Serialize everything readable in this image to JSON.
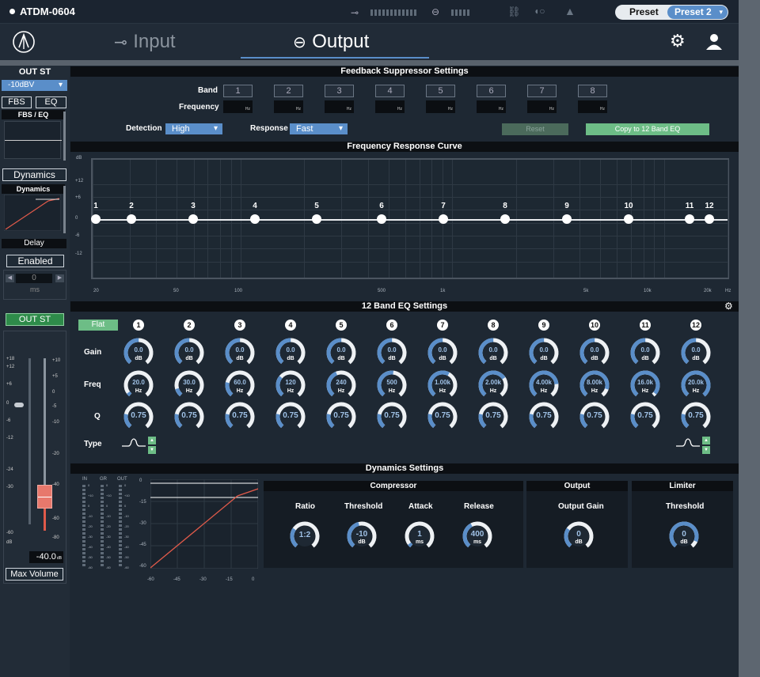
{
  "app": {
    "device": "ATDM-0604",
    "preset_label": "Preset",
    "preset_value": "Preset 2"
  },
  "nav": {
    "input": "Input",
    "output": "Output"
  },
  "left": {
    "channel": "OUT ST",
    "level_select": "-10dBV",
    "fbs_btn": "FBS",
    "eq_btn": "EQ",
    "fbs_eq_label": "FBS / EQ",
    "dynamics_btn": "Dynamics",
    "dynamics_label": "Dynamics",
    "delay_label": "Delay",
    "enabled_btn": "Enabled",
    "delay_value": "0",
    "delay_unit": "ms",
    "out_btn": "OUT ST",
    "fader_scale_left": [
      "+18",
      "+12",
      "+6",
      "0",
      "-6",
      "-12",
      "-24",
      "-30",
      "-60",
      "dB"
    ],
    "fader_scale_right": [
      "+10",
      "+5",
      "0",
      "-5",
      "-10",
      "-20",
      "-40",
      "-60",
      "-80"
    ],
    "fader_value": "-40.0",
    "fader_unit": "dB",
    "max_volume_btn": "Max Volume"
  },
  "fbs": {
    "title": "Feedback Suppressor Settings",
    "band_label": "Band",
    "freq_label": "Frequency",
    "bands": [
      "1",
      "2",
      "3",
      "4",
      "5",
      "6",
      "7",
      "8"
    ],
    "hz": "Hz",
    "detection_label": "Detection",
    "detection_value": "High",
    "response_label": "Response",
    "response_value": "Fast",
    "reset_btn": "Reset",
    "copy_btn": "Copy to 12 Band EQ"
  },
  "curve": {
    "title": "Frequency Response Curve",
    "y_unit": "dB",
    "y_ticks": [
      "+12",
      "+6",
      "0",
      "-6",
      "-12"
    ],
    "x_ticks": [
      "20",
      "50",
      "100",
      "500",
      "1k",
      "5k",
      "10k",
      "20k"
    ],
    "x_unit": "Hz",
    "nodes": [
      "1",
      "2",
      "3",
      "4",
      "5",
      "6",
      "7",
      "8",
      "9",
      "10",
      "11",
      "12"
    ]
  },
  "eq": {
    "title": "12 Band EQ Settings",
    "flat_btn": "Flat",
    "gain_label": "Gain",
    "freq_label": "Freq",
    "q_label": "Q",
    "type_label": "Type",
    "bands": [
      "1",
      "2",
      "3",
      "4",
      "5",
      "6",
      "7",
      "8",
      "9",
      "10",
      "11",
      "12"
    ],
    "gain": [
      "0.0",
      "0.0",
      "0.0",
      "0.0",
      "0.0",
      "0.0",
      "0.0",
      "0.0",
      "0.0",
      "0.0",
      "0.0",
      "0.0"
    ],
    "gain_unit": "dB",
    "freq": [
      "20.0",
      "30.0",
      "60.0",
      "120",
      "240",
      "500",
      "1.00k",
      "2.00k",
      "4.00k",
      "8.00k",
      "16.0k",
      "20.0k"
    ],
    "freq_fill": [
      0.05,
      0.12,
      0.22,
      0.32,
      0.42,
      0.52,
      0.6,
      0.7,
      0.8,
      0.88,
      0.96,
      1.0
    ],
    "freq_unit": "Hz",
    "q": [
      "0.75",
      "0.75",
      "0.75",
      "0.75",
      "0.75",
      "0.75",
      "0.75",
      "0.75",
      "0.75",
      "0.75",
      "0.75",
      "0.75"
    ]
  },
  "dyn": {
    "title": "Dynamics Settings",
    "meter_labels": [
      "IN",
      "GR",
      "OUT"
    ],
    "meter_scale": [
      "0",
      "+10",
      "0",
      "-10",
      "-20",
      "-30",
      "-40",
      "-50",
      "-60"
    ],
    "graph_y": [
      "0",
      "-15",
      "-30",
      "-45",
      "-60"
    ],
    "graph_x": [
      "-60",
      "-45",
      "-30",
      "-15",
      "0"
    ],
    "compressor": "Compressor",
    "ratio_label": "Ratio",
    "ratio": "1:2",
    "threshold_label": "Threshold",
    "threshold": "-10",
    "threshold_unit": "dB",
    "attack_label": "Attack",
    "attack": "1",
    "attack_unit": "ms",
    "release_label": "Release",
    "release": "400",
    "release_unit": "ms",
    "output": "Output",
    "output_gain_label": "Output Gain",
    "output_gain": "0",
    "output_gain_unit": "dB",
    "limiter": "Limiter",
    "limiter_threshold_label": "Threshold",
    "limiter_threshold": "0",
    "limiter_threshold_unit": "dB"
  }
}
